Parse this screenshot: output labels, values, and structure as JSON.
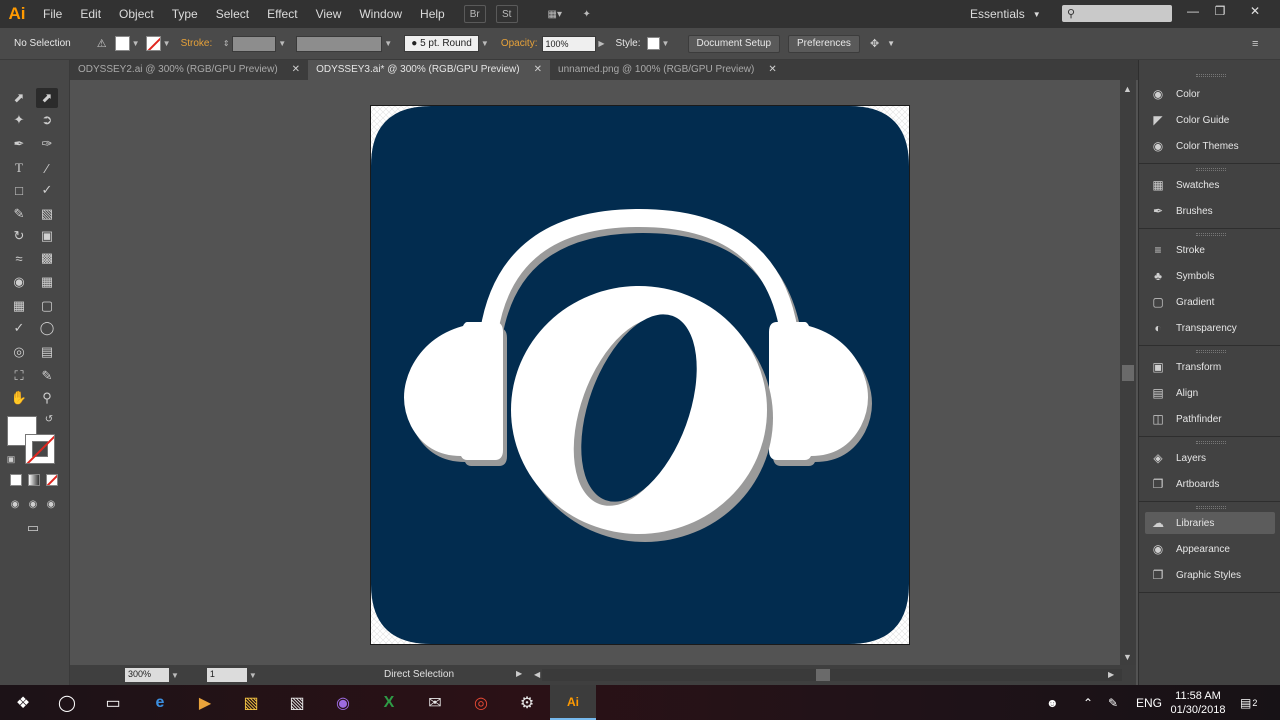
{
  "app": {
    "logo": "Ai",
    "workspace": "Essentials"
  },
  "menu": [
    "File",
    "Edit",
    "Object",
    "Type",
    "Select",
    "Effect",
    "View",
    "Window",
    "Help"
  ],
  "control_bar": {
    "selection": "No Selection",
    "stroke_label": "Stroke:",
    "stroke_style": "5 pt. Round",
    "opacity_label": "Opacity:",
    "opacity_value": "100%",
    "style_label": "Style:",
    "document_setup": "Document Setup",
    "preferences": "Preferences"
  },
  "tabs": [
    {
      "label": "ODYSSEY2.ai @ 300% (RGB/GPU Preview)",
      "active": false
    },
    {
      "label": "ODYSSEY3.ai* @ 300% (RGB/GPU Preview)",
      "active": true
    },
    {
      "label": "unnamed.png @ 100% (RGB/GPU Preview)",
      "active": false
    }
  ],
  "status_bar": {
    "zoom": "300%",
    "page": "1",
    "tool": "Direct Selection"
  },
  "panels": [
    {
      "label": "Color",
      "icon": "color-icon"
    },
    {
      "label": "Color Guide",
      "icon": "color-guide-icon"
    },
    {
      "label": "Color Themes",
      "icon": "color-themes-icon"
    },
    {
      "label": "Swatches",
      "icon": "swatches-icon"
    },
    {
      "label": "Brushes",
      "icon": "brushes-icon"
    },
    {
      "label": "Stroke",
      "icon": "stroke-icon"
    },
    {
      "label": "Symbols",
      "icon": "symbols-icon"
    },
    {
      "label": "Gradient",
      "icon": "gradient-icon"
    },
    {
      "label": "Transparency",
      "icon": "transparency-icon"
    },
    {
      "label": "Transform",
      "icon": "transform-icon"
    },
    {
      "label": "Align",
      "icon": "align-icon"
    },
    {
      "label": "Pathfinder",
      "icon": "pathfinder-icon"
    },
    {
      "label": "Layers",
      "icon": "layers-icon"
    },
    {
      "label": "Artboards",
      "icon": "artboards-icon"
    },
    {
      "label": "Libraries",
      "icon": "libraries-icon"
    },
    {
      "label": "Appearance",
      "icon": "appearance-icon"
    },
    {
      "label": "Graphic Styles",
      "icon": "graphic-styles-icon"
    }
  ],
  "artwork": {
    "background": "#022c4f",
    "foreground": "#ffffff",
    "shadow": "#9a9a9a"
  },
  "taskbar": {
    "time": "11:58 AM",
    "date": "01/30/2018",
    "language": "ENG",
    "notifications": "2"
  },
  "colors": {
    "accent": "#ff9a00",
    "panel": "#424242",
    "canvas": "#535353"
  }
}
